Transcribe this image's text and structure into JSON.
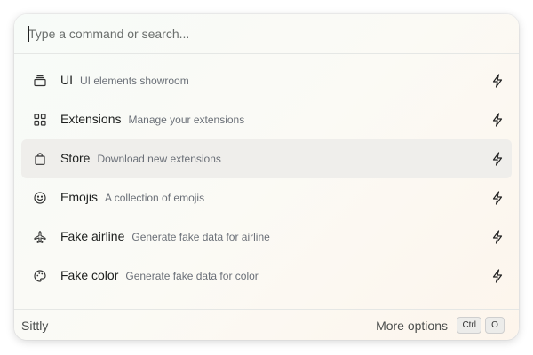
{
  "search": {
    "placeholder": "Type a command or search...",
    "value": ""
  },
  "commands": [
    {
      "title": "UI",
      "description": "UI elements showroom",
      "icon": "stack-icon",
      "action_icon": "bolt-icon",
      "selected": false
    },
    {
      "title": "Extensions",
      "description": "Manage your extensions",
      "icon": "grid-icon",
      "action_icon": "bolt-icon",
      "selected": false
    },
    {
      "title": "Store",
      "description": "Download new extensions",
      "icon": "shopping-bag-icon",
      "action_icon": "bolt-icon",
      "selected": true
    },
    {
      "title": "Emojis",
      "description": "A collection of emojis",
      "icon": "smiley-icon",
      "action_icon": "bolt-icon",
      "selected": false
    },
    {
      "title": "Fake airline",
      "description": "Generate fake data for airline",
      "icon": "plane-icon",
      "action_icon": "bolt-icon",
      "selected": false
    },
    {
      "title": "Fake color",
      "description": "Generate fake data for color",
      "icon": "palette-icon",
      "action_icon": "bolt-icon",
      "selected": false
    }
  ],
  "footer": {
    "app_name": "Sittly",
    "more_options_label": "More options",
    "shortcut_keys": [
      "Ctrl",
      "O"
    ]
  },
  "colors": {
    "selected_row": "#efeeeb",
    "text_primary": "#1d1f1e",
    "text_secondary": "#6b7078"
  }
}
